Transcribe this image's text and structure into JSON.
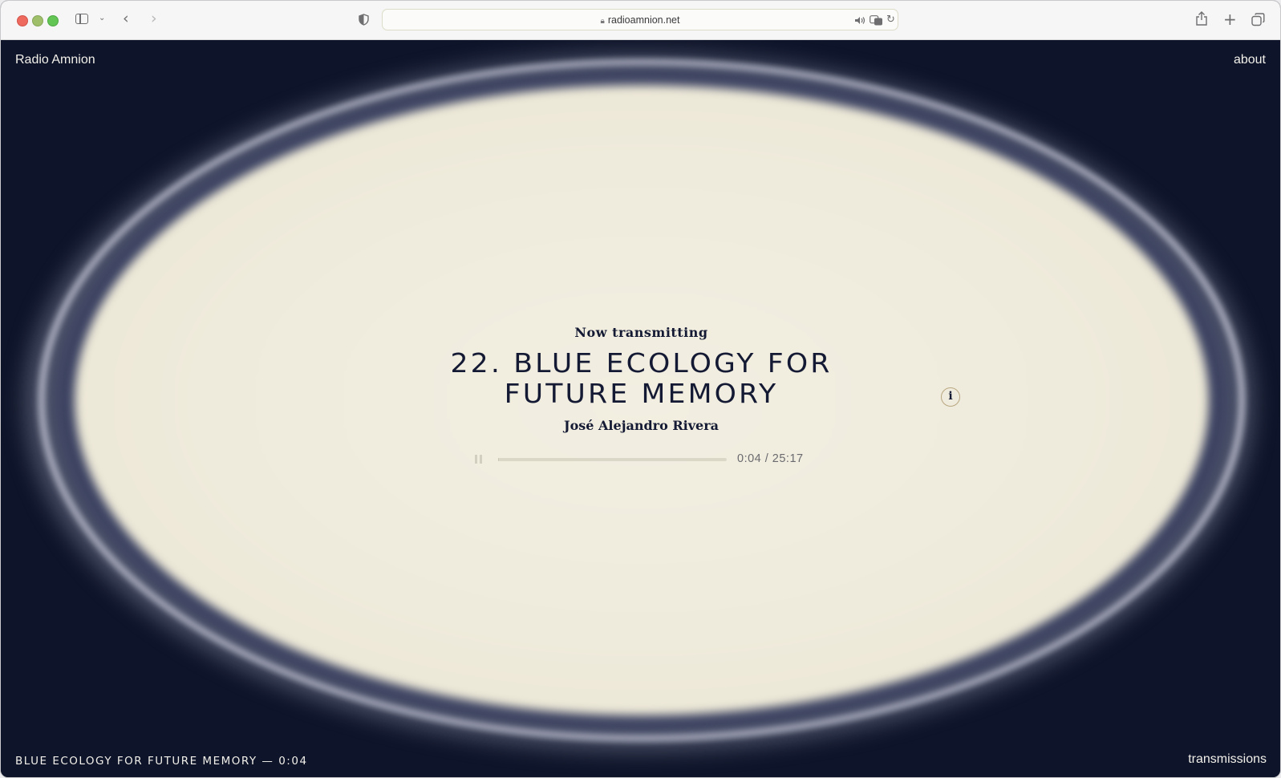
{
  "browser": {
    "url": "radioamnion.net",
    "icons": [
      "sidebar-icon",
      "chevron-down-icon",
      "back-icon",
      "forward-icon",
      "shield-icon",
      "lock-icon",
      "speaker-icon",
      "translate-icon",
      "reload-icon",
      "share-icon",
      "new-tab-icon",
      "tabs-overview-icon"
    ]
  },
  "header": {
    "site_title": "Radio Amnion",
    "about_label": "about"
  },
  "now_playing": {
    "label": "Now transmitting",
    "title_line1": "22. BLUE ECOLOGY FOR",
    "title_line2": "FUTURE MEMORY",
    "author": "José Alejandro Rivera",
    "info_label": "i",
    "time_display": "0:04 / 25:17",
    "progress": 0.003
  },
  "footer": {
    "now_playing": "BLUE ECOLOGY FOR FUTURE MEMORY — 0:04",
    "transmissions_label": "transmissions"
  },
  "colors": {
    "background": "#0e1429",
    "disc": "#efebdc",
    "text_dark": "#141a33",
    "text_light": "#f2f0ea",
    "info_border": "#b8a67f"
  }
}
